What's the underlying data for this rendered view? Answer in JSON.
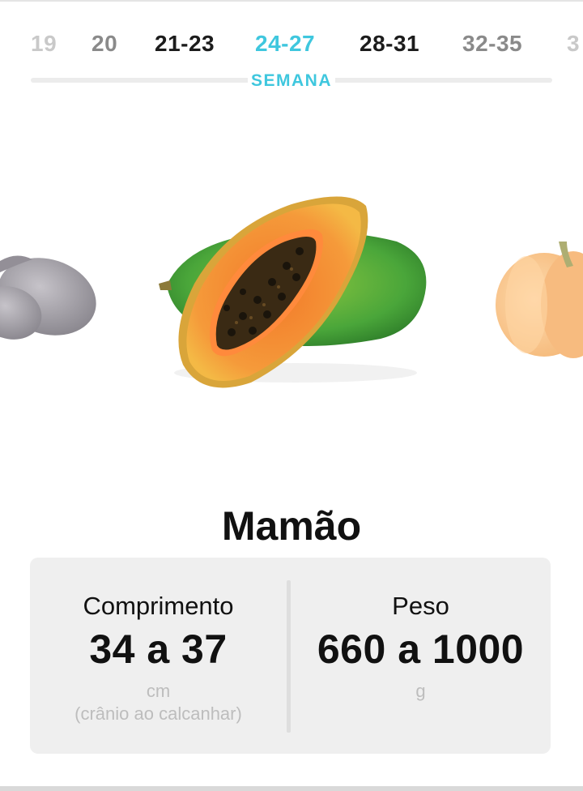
{
  "weeks": {
    "items": [
      {
        "label": "19",
        "state": "far"
      },
      {
        "label": "20",
        "state": "mid"
      },
      {
        "label": "21-23",
        "state": "near"
      },
      {
        "label": "24-27",
        "state": "active"
      },
      {
        "label": "28-31",
        "state": "near"
      },
      {
        "label": "32-35",
        "state": "mid"
      },
      {
        "label": "3",
        "state": "far"
      }
    ],
    "caption": "SEMANA"
  },
  "fruit": {
    "name": "Mamão",
    "previous_icon": "eggplant-image",
    "current_icon": "papaya-image",
    "next_icon": "pumpkin-image"
  },
  "length": {
    "label": "Comprimento",
    "value": "34 a 37",
    "unit": "cm",
    "note": "(crânio ao calcanhar)"
  },
  "weight": {
    "label": "Peso",
    "value": "660 a 1000",
    "unit": "g"
  },
  "colors": {
    "accent": "#3fc7de",
    "card_background": "#efefef"
  }
}
